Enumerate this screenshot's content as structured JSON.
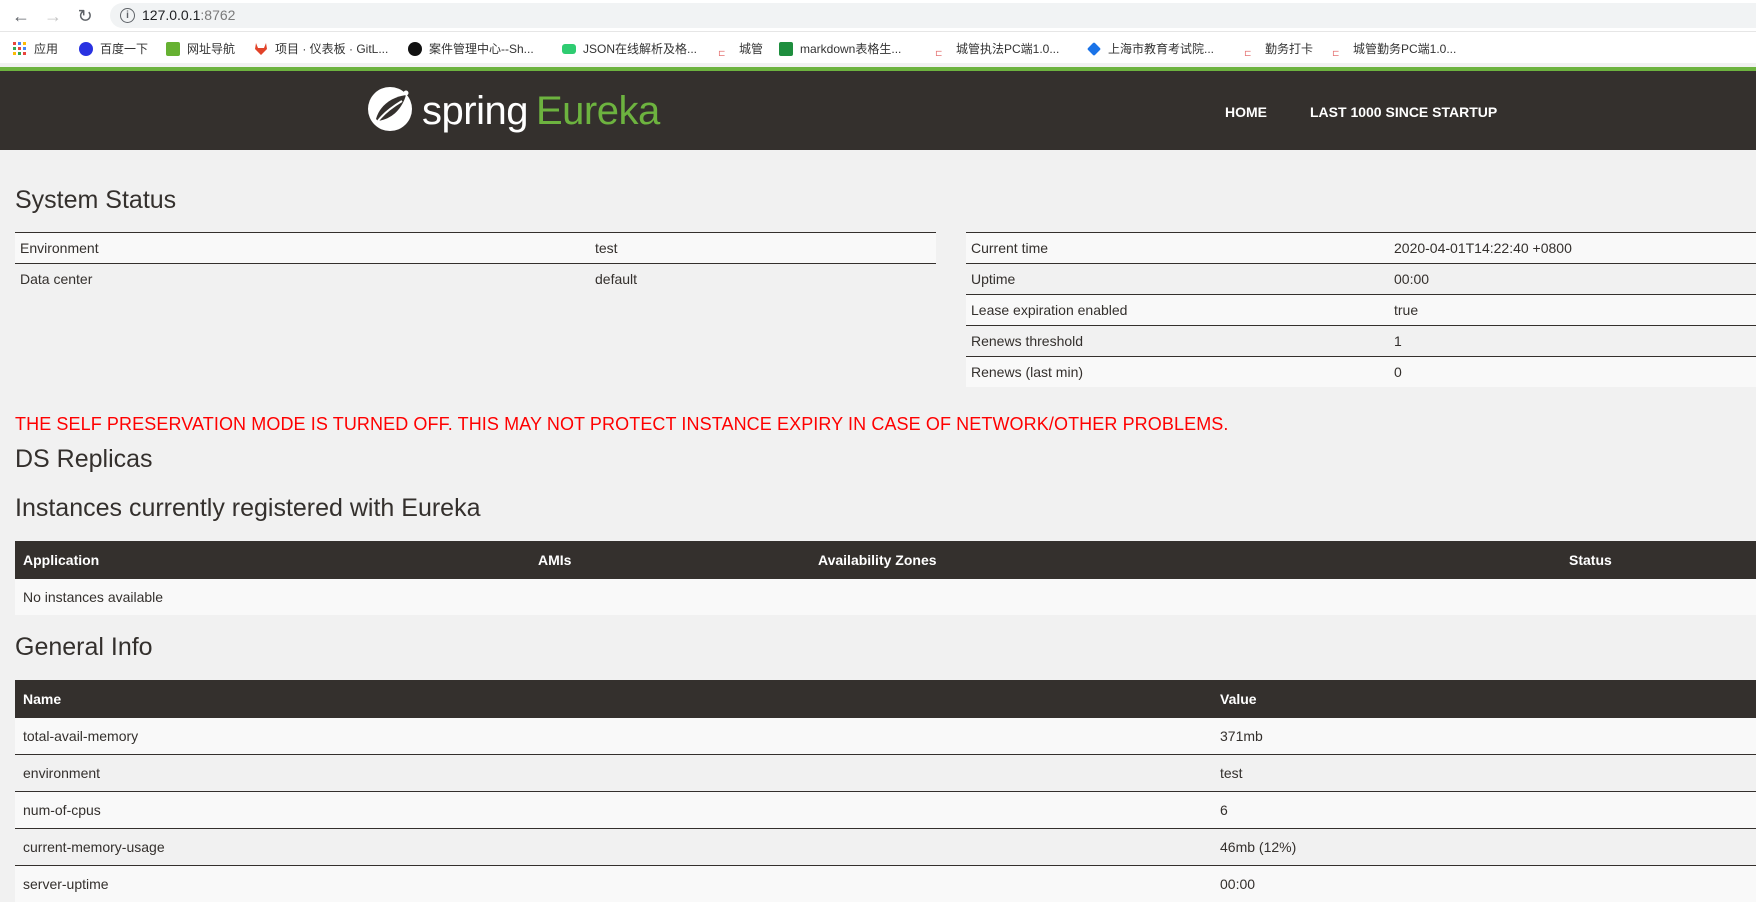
{
  "browser": {
    "url_host": "127.0.0.1",
    "url_port": ":8762",
    "bookmarks": [
      {
        "label": "应用",
        "icon": "apps-grid-icon",
        "color": "#e8453c"
      },
      {
        "label": "百度一下",
        "icon": "baidu-paw-icon",
        "color": "#2932e1"
      },
      {
        "label": "网址导航",
        "icon": "hao123-icon",
        "color": "#66b132"
      },
      {
        "label": "项目 · 仪表板 · GitL...",
        "icon": "gitlab-fox-icon",
        "color": "#e24329"
      },
      {
        "label": "案件管理中心--Sh...",
        "icon": "feather-icon",
        "color": "#111111"
      },
      {
        "label": "JSON在线解析及格...",
        "icon": "json-icon",
        "color": "#2ecc71"
      },
      {
        "label": "城管",
        "icon": "page-icon",
        "color": "#e57373"
      },
      {
        "label": "markdown表格生...",
        "icon": "table-icon",
        "color": "#1e8e3e"
      },
      {
        "label": "城管执法PC端1.0...",
        "icon": "page-icon",
        "color": "#e57373"
      },
      {
        "label": "上海市教育考试院...",
        "icon": "edu-icon",
        "color": "#1a73e8"
      },
      {
        "label": "勤务打卡",
        "icon": "page-icon",
        "color": "#e57373"
      },
      {
        "label": "城管勤务PC端1.0...",
        "icon": "page-icon",
        "color": "#e57373"
      }
    ]
  },
  "navbar": {
    "brand_spring": "spring",
    "brand_eureka": "Eureka",
    "links": [
      "HOME",
      "LAST 1000 SINCE STARTUP"
    ],
    "accent": "#6db33f",
    "background": "#34302d"
  },
  "system_status": {
    "title": "System Status",
    "left": [
      {
        "key": "Environment",
        "value": "test"
      },
      {
        "key": "Data center",
        "value": "default"
      }
    ],
    "right": [
      {
        "key": "Current time",
        "value": "2020-04-01T14:22:40 +0800"
      },
      {
        "key": "Uptime",
        "value": "00:00"
      },
      {
        "key": "Lease expiration enabled",
        "value": "true"
      },
      {
        "key": "Renews threshold",
        "value": "1"
      },
      {
        "key": "Renews (last min)",
        "value": "0"
      }
    ]
  },
  "warning": "THE SELF PRESERVATION MODE IS TURNED OFF. THIS MAY NOT PROTECT INSTANCE EXPIRY IN CASE OF NETWORK/OTHER PROBLEMS.",
  "ds_replicas": {
    "title": "DS Replicas"
  },
  "instances": {
    "title": "Instances currently registered with Eureka",
    "columns": [
      "Application",
      "AMIs",
      "Availability Zones",
      "Status"
    ],
    "empty_message": "No instances available"
  },
  "general_info": {
    "title": "General Info",
    "columns": [
      "Name",
      "Value"
    ],
    "rows": [
      {
        "name": "total-avail-memory",
        "value": "371mb"
      },
      {
        "name": "environment",
        "value": "test"
      },
      {
        "name": "num-of-cpus",
        "value": "6"
      },
      {
        "name": "current-memory-usage",
        "value": "46mb (12%)"
      },
      {
        "name": "server-uptime",
        "value": "00:00"
      }
    ]
  }
}
